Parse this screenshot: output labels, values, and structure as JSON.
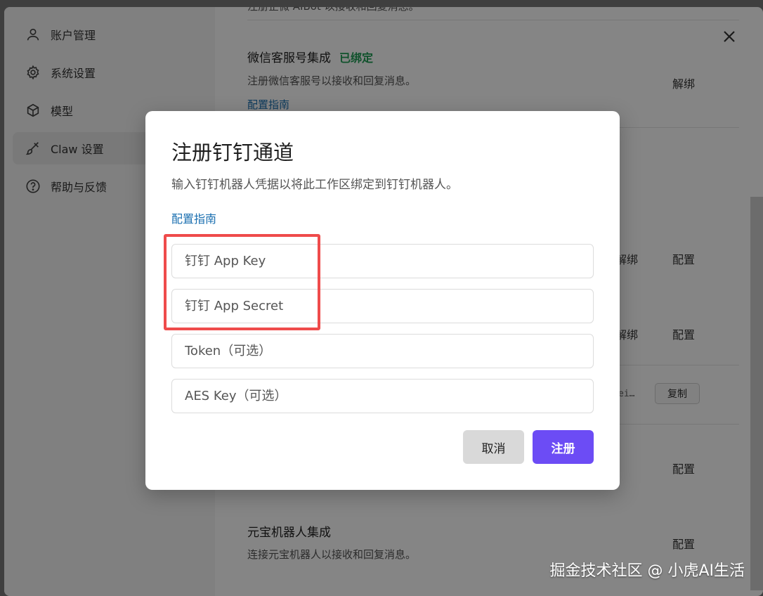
{
  "sidebar": {
    "items": [
      {
        "label": "账户管理",
        "icon": "user-icon"
      },
      {
        "label": "系统设置",
        "icon": "gear-icon"
      },
      {
        "label": "模型",
        "icon": "cube-icon"
      },
      {
        "label": "Claw 设置",
        "icon": "brush-icon",
        "active": true
      },
      {
        "label": "帮助与反馈",
        "icon": "help-icon"
      }
    ]
  },
  "content": {
    "top_fragment": "注册企微 AIBot 以接收和回复消息。",
    "wechat_kf": {
      "title": "微信客服号集成",
      "status": "已绑定",
      "desc": "注册微信客服号以接收和回复消息。",
      "guide": "配置指南",
      "unbind": "解绑"
    },
    "row_a": {
      "unbind": "解绑",
      "config": "配置"
    },
    "row_b": {
      "unbind": "解绑",
      "config": "配置"
    },
    "secret_fragment": "ei…",
    "copy": "复制",
    "row_c": {
      "config": "配置"
    },
    "yuanbao": {
      "title": "元宝机器人集成",
      "desc": "连接元宝机器人以接收和回复消息。",
      "config": "配置"
    }
  },
  "modal": {
    "title": "注册钉钉通道",
    "desc": "输入钉钉机器人凭据以将此工作区绑定到钉钉机器人。",
    "guide": "配置指南",
    "fields": {
      "app_key": "钉钉 App Key",
      "app_secret": "钉钉 App Secret",
      "token": "Token（可选）",
      "aes_key": "AES Key（可选）"
    },
    "cancel": "取消",
    "register": "注册"
  },
  "watermark": "掘金技术社区 @ 小虎AI生活",
  "colors": {
    "accent": "#6c4cf5",
    "bound": "#1f9d55",
    "link": "#1a6fb0",
    "highlight": "#ef4b4b"
  }
}
